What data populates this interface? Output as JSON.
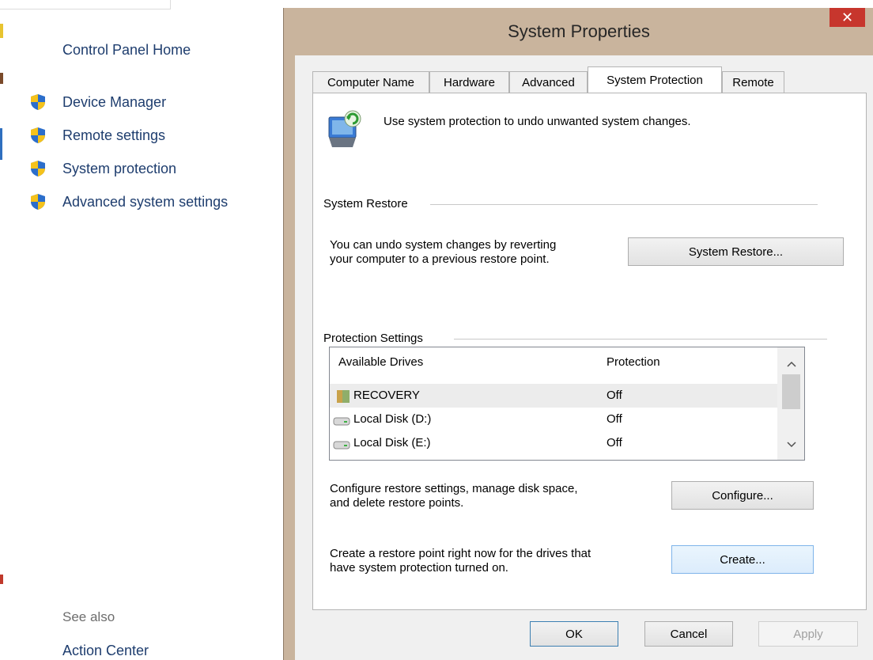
{
  "left_panel": {
    "home_link": "Control Panel Home",
    "links": [
      {
        "label": "Device Manager",
        "icon": "uac-shield-icon"
      },
      {
        "label": "Remote settings",
        "icon": "uac-shield-icon"
      },
      {
        "label": "System protection",
        "icon": "uac-shield-icon"
      },
      {
        "label": "Advanced system settings",
        "icon": "uac-shield-icon"
      }
    ],
    "see_also_label": "See also",
    "see_also_links": [
      "Action Center"
    ]
  },
  "dialog": {
    "title": "System Properties",
    "close_glyph": "✕",
    "tabs": [
      "Computer Name",
      "Hardware",
      "Advanced",
      "System Protection",
      "Remote"
    ],
    "active_tab": "System Protection",
    "intro_text": "Use system protection to undo unwanted system changes.",
    "system_restore": {
      "group_label": "System Restore",
      "description_line1": "You can undo system changes by reverting",
      "description_line2": "your computer to a previous restore point.",
      "button_label": "System Restore..."
    },
    "protection_settings": {
      "group_label": "Protection Settings",
      "columns": [
        "Available Drives",
        "Protection"
      ],
      "drives": [
        {
          "name": "RECOVERY",
          "protection": "Off",
          "icon": "recovery-drive-icon"
        },
        {
          "name": "Local Disk (D:)",
          "protection": "Off",
          "icon": "hard-disk-icon"
        },
        {
          "name": "Local Disk (E:)",
          "protection": "Off",
          "icon": "hard-disk-icon"
        }
      ],
      "configure_line1": "Configure restore settings, manage disk space,",
      "configure_line2": "and delete restore points.",
      "configure_button": "Configure...",
      "create_line1": "Create a restore point right now for the drives that",
      "create_line2": "have system protection turned on.",
      "create_button": "Create..."
    },
    "footer": {
      "ok": "OK",
      "cancel": "Cancel",
      "apply": "Apply"
    }
  },
  "colors": {
    "link_blue": "#1e3d6e",
    "dialog_frame": "#c9b49d",
    "close_red": "#c7362d",
    "focus_blue": "#7eb4ea"
  }
}
